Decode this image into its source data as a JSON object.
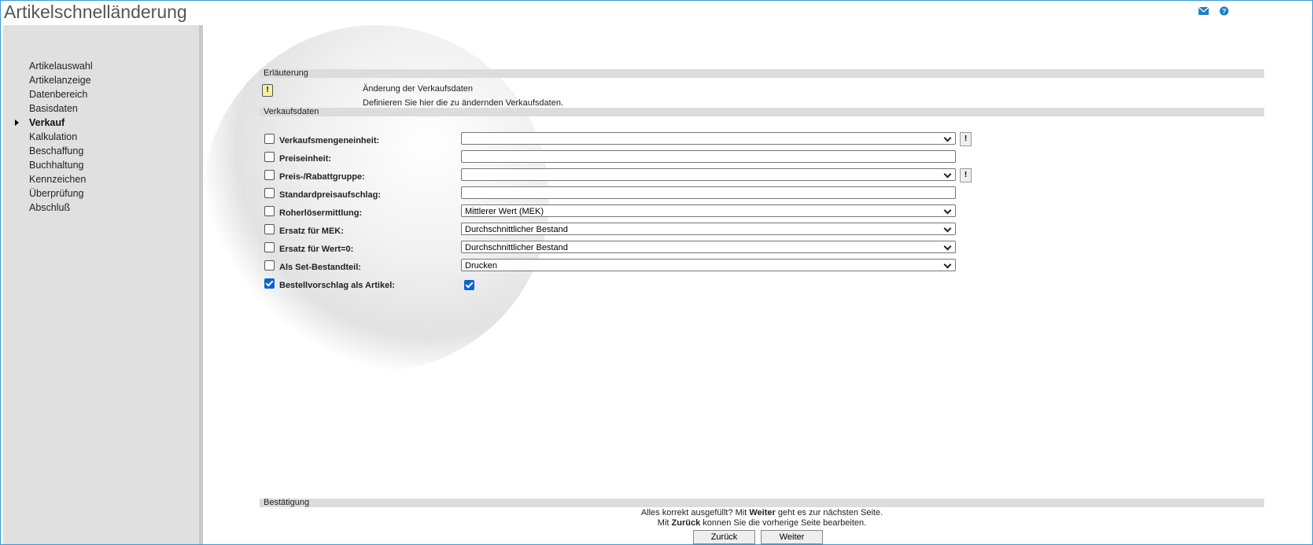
{
  "window": {
    "title": "Artikelschnelländerung"
  },
  "topbar": {
    "icons": [
      "mail-icon",
      "help-icon"
    ]
  },
  "sidebar": {
    "items": [
      {
        "label": "Artikelauswahl",
        "active": false
      },
      {
        "label": "Artikelanzeige",
        "active": false
      },
      {
        "label": "Datenbereich",
        "active": false
      },
      {
        "label": "Basisdaten",
        "active": false
      },
      {
        "label": "Verkauf",
        "active": true
      },
      {
        "label": "Kalkulation",
        "active": false
      },
      {
        "label": "Beschaffung",
        "active": false
      },
      {
        "label": "Buchhaltung",
        "active": false
      },
      {
        "label": "Kennzeichen",
        "active": false
      },
      {
        "label": "Überprüfung",
        "active": false
      },
      {
        "label": "Abschluß",
        "active": false
      }
    ]
  },
  "sections": {
    "erlaeuterung": "Erläuterung",
    "verkaufsdaten": "Verkaufsdaten",
    "bestaetigung": "Bestätigung"
  },
  "info": {
    "icon": "alert-icon",
    "line1": "Änderung der Verkaufsdaten",
    "line2": "Definieren Sie hier die zu ändernden Verkaufsdaten."
  },
  "fields": [
    {
      "label": "Verkaufsmengeneinheit:",
      "checked": false,
      "type": "select",
      "value": "",
      "extra_button": "!"
    },
    {
      "label": "Preiseinheit:",
      "checked": false,
      "type": "text",
      "value": ""
    },
    {
      "label": "Preis-/Rabattgruppe:",
      "checked": false,
      "type": "select",
      "value": "",
      "extra_button": "!"
    },
    {
      "label": "Standardpreisaufschlag:",
      "checked": false,
      "type": "text",
      "value": ""
    },
    {
      "label": "Roherlösermittlung:",
      "checked": false,
      "type": "select",
      "value": "Mittlerer Wert (MEK)"
    },
    {
      "label": "Ersatz für MEK:",
      "checked": false,
      "type": "select",
      "value": "Durchschnittlicher Bestand"
    },
    {
      "label": "Ersatz für Wert=0:",
      "checked": false,
      "type": "select",
      "value": "Durchschnittlicher Bestand"
    },
    {
      "label": "Als Set-Bestandteil:",
      "checked": false,
      "type": "select",
      "value": "Drucken"
    },
    {
      "label": "Bestellvorschlag als Artikel:",
      "checked": true,
      "type": "checkbox",
      "value_checked": true
    }
  ],
  "confirmation": {
    "line1_a": "Alles korrekt ausgefüllt?  Mit ",
    "line1_b": "Weiter",
    "line1_c": " geht es zur nächsten Seite.",
    "line2_a": "Mit ",
    "line2_b": "Zurück",
    "line2_c": " konnen Sie die vorherige Seite bearbeiten."
  },
  "buttons": {
    "back": "Zurück",
    "next": "Weiter"
  },
  "colors": {
    "accent": "#0b63d6",
    "frame": "#3c9ad6",
    "sidebar": "#e0e0e0"
  }
}
